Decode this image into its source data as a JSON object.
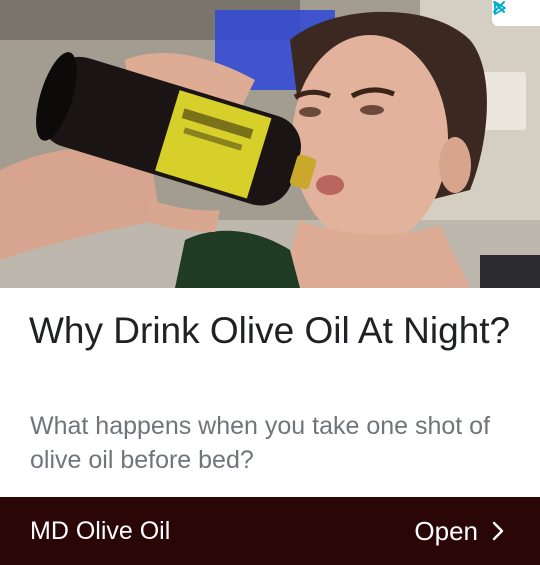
{
  "ad": {
    "headline": "Why Drink Olive Oil At Night?",
    "subtitle": "What happens when you take one shot of olive oil before bed?",
    "advertiser": "MD Olive Oil",
    "cta_label": "Open",
    "cta_icon": "chevron-right-icon",
    "adchoices_icons": [
      "adchoices-play-icon",
      "close-icon"
    ],
    "colors": {
      "footer_bg": "#2a0606",
      "headline": "#202124",
      "subtitle": "#70757a",
      "adchoices": "#00aecd"
    }
  },
  "photo": {
    "subject": "woman drinking from a dark bottle with a yellow label"
  }
}
